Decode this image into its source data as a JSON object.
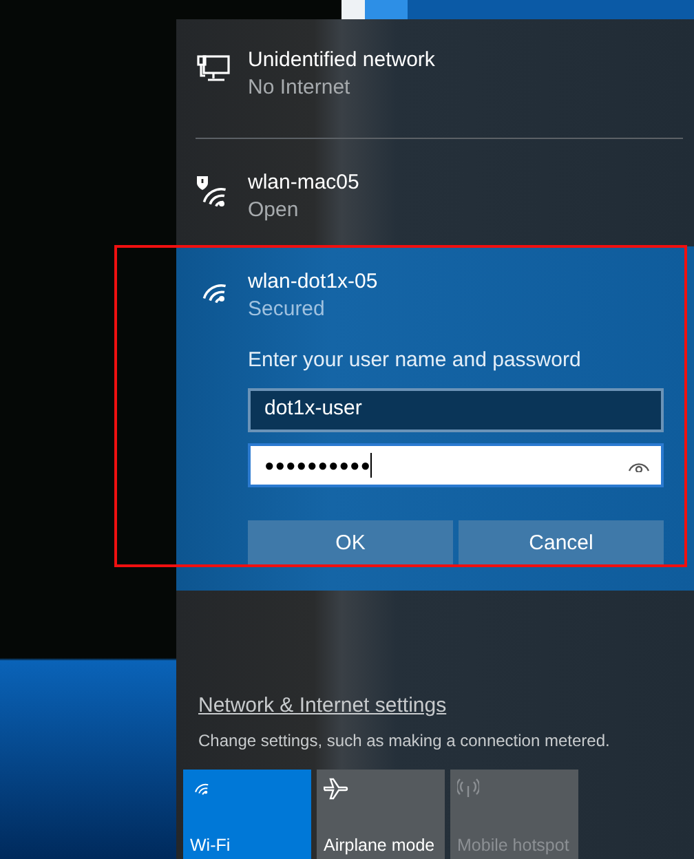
{
  "networks": [
    {
      "kind": "wired",
      "name": "Unidentified network",
      "status": "No Internet",
      "selected": false
    },
    {
      "kind": "wifi-warning",
      "name": "wlan-mac05",
      "status": "Open",
      "selected": false
    },
    {
      "kind": "wifi",
      "name": "wlan-dot1x-05",
      "status": "Secured",
      "selected": true,
      "login": {
        "prompt": "Enter your user name and password",
        "username": "dot1x-user",
        "password": "●●●●●●●●●●",
        "buttons": [
          "OK",
          "Cancel"
        ]
      }
    }
  ],
  "settings": {
    "link": "Network & Internet settings",
    "description": "Change settings, such as making a connection metered."
  },
  "tiles": [
    {
      "kind": "wifi",
      "label": "Wi-Fi",
      "on": true,
      "disabled": false
    },
    {
      "kind": "airplane",
      "label": "Airplane mode",
      "on": false,
      "disabled": false
    },
    {
      "kind": "hotspot",
      "label": "Mobile hotspot",
      "on": false,
      "disabled": true
    }
  ]
}
